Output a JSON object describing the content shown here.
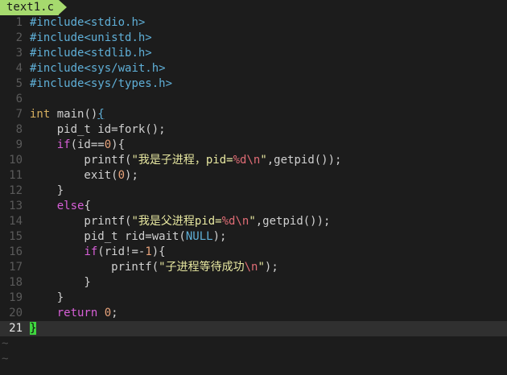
{
  "window": {
    "tab_title": "text1.c"
  },
  "editor": {
    "lines": [
      {
        "n": "1",
        "tokens": [
          {
            "c": "kw-pre",
            "t": "#include"
          },
          {
            "c": "hdr",
            "t": "<stdio.h>"
          }
        ]
      },
      {
        "n": "2",
        "tokens": [
          {
            "c": "kw-pre",
            "t": "#include"
          },
          {
            "c": "hdr",
            "t": "<unistd.h>"
          }
        ]
      },
      {
        "n": "3",
        "tokens": [
          {
            "c": "kw-pre",
            "t": "#include"
          },
          {
            "c": "hdr",
            "t": "<stdlib.h>"
          }
        ]
      },
      {
        "n": "4",
        "tokens": [
          {
            "c": "kw-pre",
            "t": "#include"
          },
          {
            "c": "hdr",
            "t": "<sys/wait.h>"
          }
        ]
      },
      {
        "n": "5",
        "tokens": [
          {
            "c": "kw-pre",
            "t": "#include"
          },
          {
            "c": "hdr",
            "t": "<sys/types.h>"
          }
        ]
      },
      {
        "n": "6",
        "tokens": []
      },
      {
        "n": "7",
        "tokens": [
          {
            "c": "type",
            "t": "int"
          },
          {
            "c": "plain",
            "t": " main()"
          },
          {
            "c": "brace-match",
            "t": "{"
          }
        ]
      },
      {
        "n": "8",
        "tokens": [
          {
            "c": "plain",
            "t": "    pid_t id=fork();"
          }
        ]
      },
      {
        "n": "9",
        "tokens": [
          {
            "c": "plain",
            "t": "    "
          },
          {
            "c": "kw",
            "t": "if"
          },
          {
            "c": "plain",
            "t": "(id=="
          },
          {
            "c": "num",
            "t": "0"
          },
          {
            "c": "plain",
            "t": "){"
          }
        ]
      },
      {
        "n": "10",
        "tokens": [
          {
            "c": "plain",
            "t": "        printf("
          },
          {
            "c": "str",
            "t": "\"我是子进程，pid="
          },
          {
            "c": "esc",
            "t": "%d\\n"
          },
          {
            "c": "str",
            "t": "\""
          },
          {
            "c": "plain",
            "t": ",getpid());"
          }
        ]
      },
      {
        "n": "11",
        "tokens": [
          {
            "c": "plain",
            "t": "        exit("
          },
          {
            "c": "num",
            "t": "0"
          },
          {
            "c": "plain",
            "t": ");"
          }
        ]
      },
      {
        "n": "12",
        "tokens": [
          {
            "c": "plain",
            "t": "    }"
          }
        ]
      },
      {
        "n": "13",
        "tokens": [
          {
            "c": "plain",
            "t": "    "
          },
          {
            "c": "kw",
            "t": "else"
          },
          {
            "c": "plain",
            "t": "{"
          }
        ]
      },
      {
        "n": "14",
        "tokens": [
          {
            "c": "plain",
            "t": "        printf("
          },
          {
            "c": "str",
            "t": "\"我是父进程pid="
          },
          {
            "c": "esc",
            "t": "%d\\n"
          },
          {
            "c": "str",
            "t": "\""
          },
          {
            "c": "plain",
            "t": ",getpid());"
          }
        ]
      },
      {
        "n": "15",
        "tokens": [
          {
            "c": "plain",
            "t": "        pid_t rid=wait("
          },
          {
            "c": "const",
            "t": "NULL"
          },
          {
            "c": "plain",
            "t": ");"
          }
        ]
      },
      {
        "n": "16",
        "tokens": [
          {
            "c": "plain",
            "t": "        "
          },
          {
            "c": "kw",
            "t": "if"
          },
          {
            "c": "plain",
            "t": "(rid!=-"
          },
          {
            "c": "num",
            "t": "1"
          },
          {
            "c": "plain",
            "t": "){"
          }
        ]
      },
      {
        "n": "17",
        "tokens": [
          {
            "c": "plain",
            "t": "            printf("
          },
          {
            "c": "str",
            "t": "\"子进程等待成功"
          },
          {
            "c": "esc",
            "t": "\\n"
          },
          {
            "c": "str",
            "t": "\""
          },
          {
            "c": "plain",
            "t": ");"
          }
        ]
      },
      {
        "n": "18",
        "tokens": [
          {
            "c": "plain",
            "t": "        }"
          }
        ]
      },
      {
        "n": "19",
        "tokens": [
          {
            "c": "plain",
            "t": "    }"
          }
        ]
      },
      {
        "n": "20",
        "tokens": [
          {
            "c": "plain",
            "t": "    "
          },
          {
            "c": "kw",
            "t": "return"
          },
          {
            "c": "plain",
            "t": " "
          },
          {
            "c": "num",
            "t": "0"
          },
          {
            "c": "plain",
            "t": ";"
          }
        ]
      },
      {
        "n": "21",
        "cursorline": true,
        "tokens": [
          {
            "c": "cursor",
            "t": "}"
          }
        ]
      }
    ],
    "empty_markers": [
      "~",
      "~"
    ]
  },
  "colors": {
    "background": "#1c1c1c",
    "tab_accent": "#a6da6e",
    "cursor": "#3fd63f",
    "cursorline": "#303030"
  }
}
